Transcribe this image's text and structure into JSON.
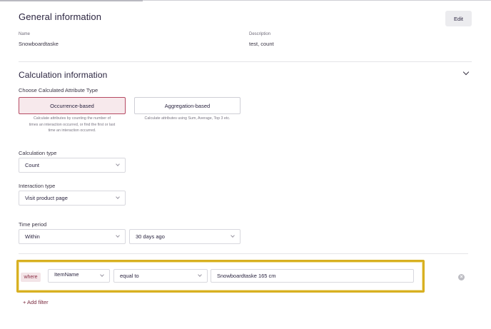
{
  "general": {
    "title": "General information",
    "edit_label": "Edit",
    "name_label": "Name",
    "name_value": "Snowboardtaske",
    "description_label": "Description",
    "description_value": "test, count"
  },
  "calculation": {
    "title": "Calculation information",
    "attribute_type_label": "Choose Calculated Attribute Type",
    "types": [
      {
        "label": "Occurrence-based",
        "selected": true,
        "hint_lines": [
          "Calculate attributes by counting the number of",
          "times an interaction occurred, or find the first or last",
          "time an interaction occurred."
        ]
      },
      {
        "label": "Aggregation-based",
        "selected": false,
        "hint_lines": [
          "Calculate attributes using Sum, Average, Top 3 etc."
        ]
      }
    ],
    "calculation_type_label": "Calculation type",
    "calculation_type_value": "Count",
    "interaction_type_label": "Interaction type",
    "interaction_type_value": "Visit product page",
    "time_period_label": "Time period",
    "time_period_mode": "Within",
    "time_period_value": "30 days ago"
  },
  "filter": {
    "where_label": "where",
    "field_value": "ItemName",
    "operator_value": "equal to",
    "text_value": "Snowboardtaske 165 cm",
    "add_filter_label": "+ Add filter"
  },
  "colors": {
    "accent": "#b64a63",
    "highlight": "#d8b021"
  },
  "icons": {
    "collapse": "chevron-down-icon",
    "dropdown": "chevron-down-icon",
    "remove": "close-circle-icon"
  }
}
